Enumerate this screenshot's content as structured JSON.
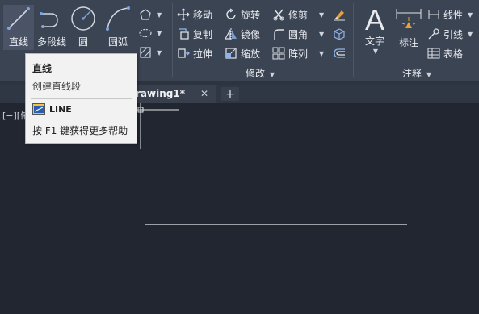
{
  "ribbon": {
    "draw": {
      "line_label": "直线",
      "polyline_label": "多段线",
      "circle_label": "圆",
      "arc_label": "圆弧"
    },
    "modify": {
      "move_label": "移动",
      "rotate_label": "旋转",
      "trim_label": "修剪",
      "copy_label": "复制",
      "mirror_label": "镜像",
      "fillet_label": "圆角",
      "stretch_label": "拉伸",
      "scale_label": "缩放",
      "array_label": "阵列",
      "panel_title": "修改"
    },
    "annotation": {
      "text_label": "文字",
      "dimension_label": "标注",
      "linear_label": "线性",
      "leader_label": "引线",
      "table_label": "表格",
      "panel_title": "注释"
    }
  },
  "tabs": {
    "drawing_tab_label": "rawing1*",
    "close_glyph": "✕",
    "new_tab_glyph": "+"
  },
  "canvas": {
    "viewport_label": "[−][俯"
  },
  "tooltip": {
    "title": "直线",
    "description": "创建直线段",
    "command": "LINE",
    "help": "按 F1 键获得更多帮助"
  }
}
